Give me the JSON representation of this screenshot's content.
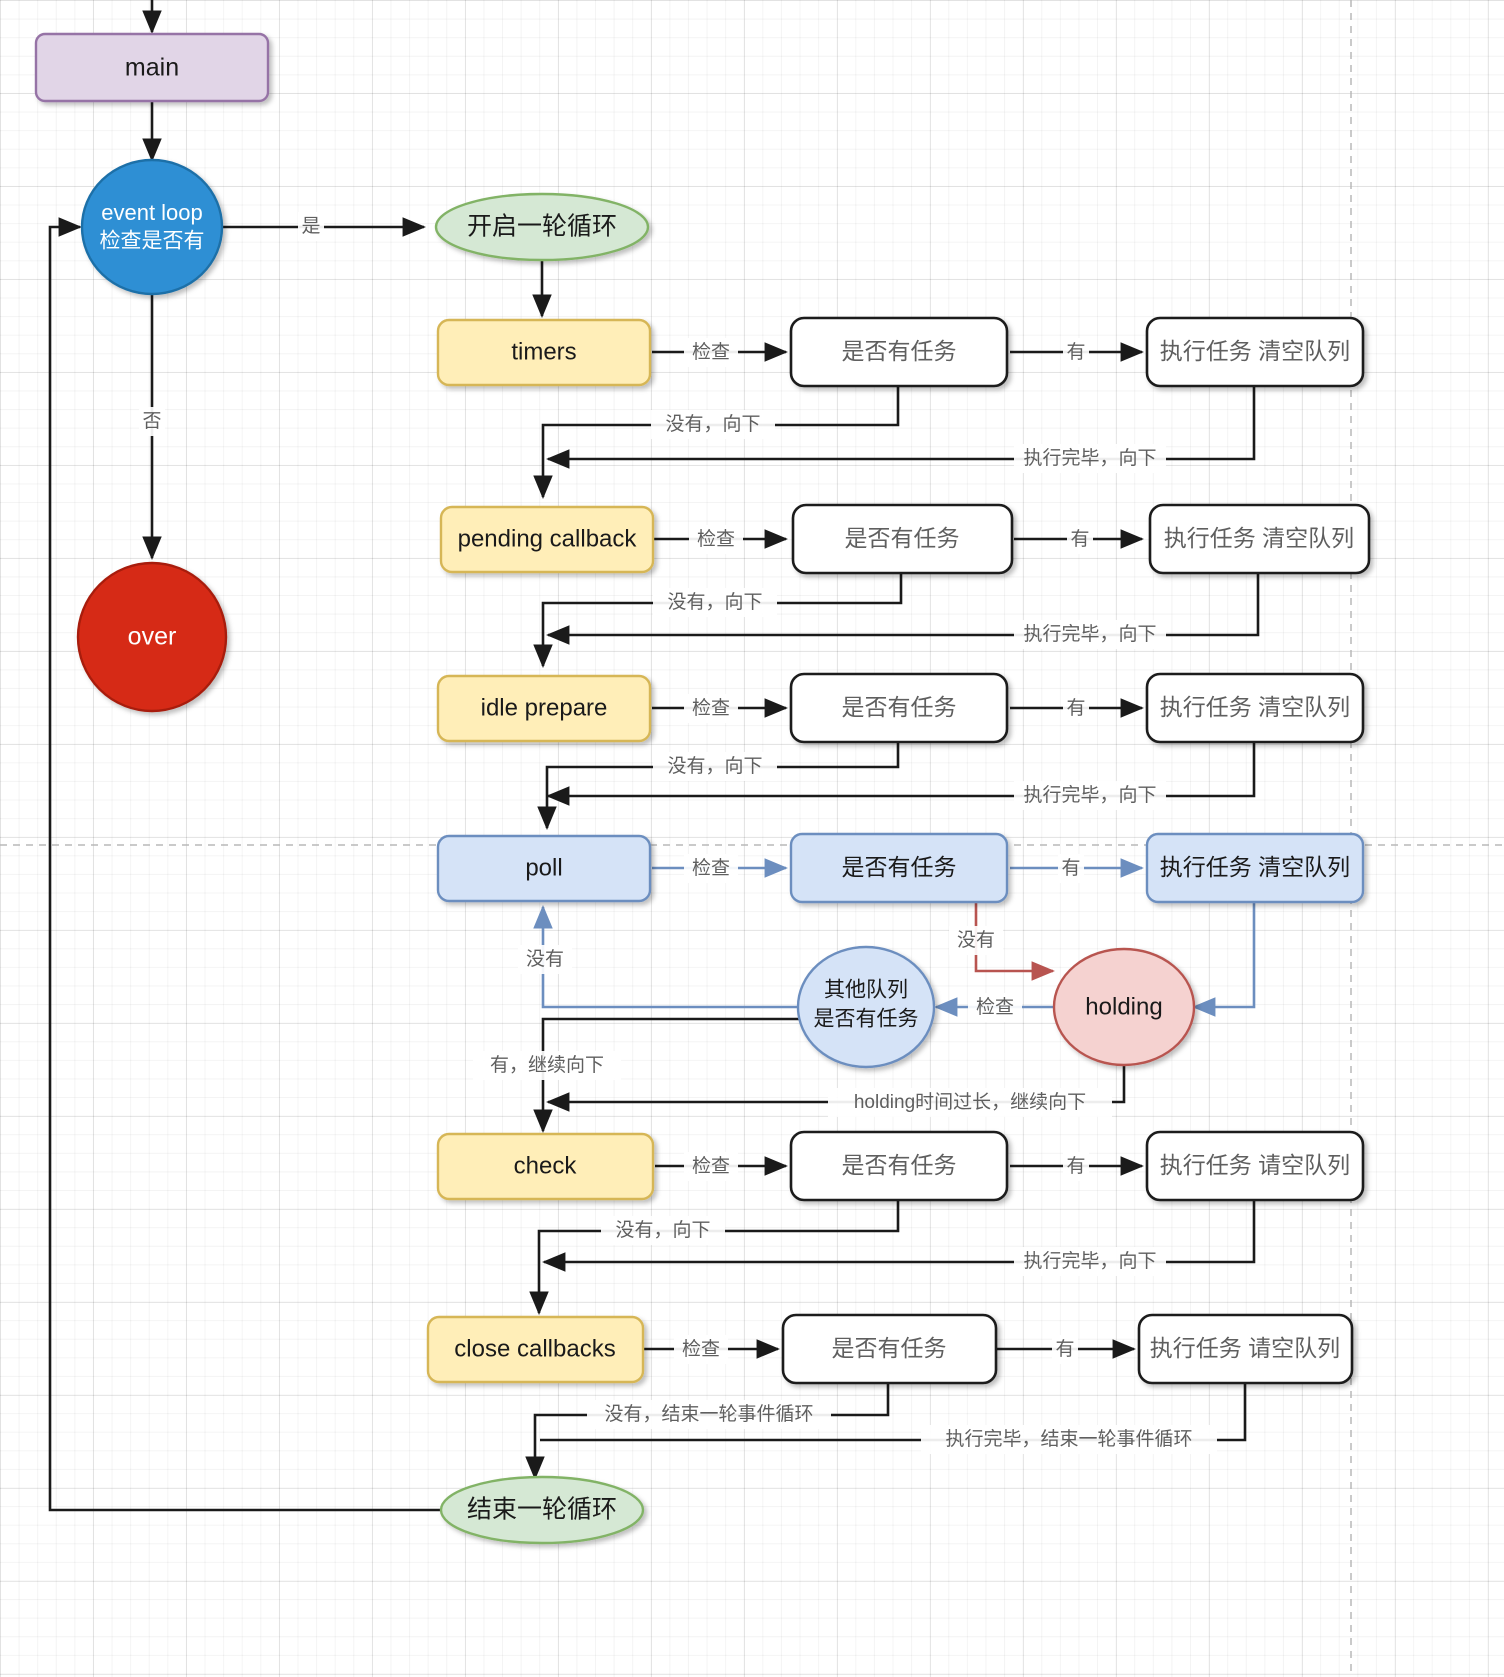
{
  "diagram": {
    "title": "Node.js event loop flowchart",
    "colors": {
      "main_fill": "#e1d5e7",
      "main_stroke": "#9673a6",
      "eventloop_fill": "#2f8fd4",
      "eventloop_stroke": "#1f6fa8",
      "over_fill": "#d62b13",
      "over_stroke": "#a81f0c",
      "ellipse_fill": "#d5e8d4",
      "ellipse_stroke": "#82b366",
      "phase_fill": "#ffeeb8",
      "phase_stroke": "#d6b656",
      "plain_fill": "#ffffff",
      "plain_stroke": "#1a1a1a",
      "poll_fill": "#d5e3f7",
      "poll_stroke": "#6c8ebf",
      "holding_fill": "#f5d2d0",
      "holding_stroke": "#b85450",
      "blue_edge": "#6c8ebf",
      "red_edge": "#b85450",
      "text_gray": "#5f5f5f",
      "text_dark": "#1a1a1a"
    },
    "nodes": {
      "main": "main",
      "event_loop_line1": "event loop",
      "event_loop_line2": "检查是否有",
      "over": "over",
      "start_round": "开启一轮循环",
      "end_round": "结束一轮循环",
      "timers": "timers",
      "pending_callback": "pending callback",
      "idle_prepare": "idle prepare",
      "poll": "poll",
      "check": "check",
      "close_callbacks": "close callbacks",
      "has_task": "是否有任务",
      "exec_clear_qing1": "执行任务 清空队列",
      "exec_clear_qing2": "执行任务 请空队列",
      "other_queue_line1": "其他队列",
      "other_queue_line2": "是否有任务",
      "holding": "holding"
    },
    "edge_labels": {
      "yes": "是",
      "no": "否",
      "check": "检查",
      "have": "有",
      "none": "没有",
      "none_down": "没有，向下",
      "done_down": "执行完毕，向下",
      "have_continue_down": "有，继续向下",
      "holding_too_long": "holding时间过长，继续向下",
      "none_end_round": "没有，结束一轮事件循环",
      "done_end_round": "执行完毕，结束一轮事件循环"
    },
    "rows": [
      {
        "id": "timers",
        "phase": "timers",
        "decision": "是否有任务",
        "action": "执行任务 清空队列",
        "style": "yellow"
      },
      {
        "id": "pending-callback",
        "phase": "pending callback",
        "decision": "是否有任务",
        "action": "执行任务 清空队列",
        "style": "yellow"
      },
      {
        "id": "idle-prepare",
        "phase": "idle prepare",
        "decision": "是否有任务",
        "action": "执行任务 清空队列",
        "style": "yellow"
      },
      {
        "id": "poll",
        "phase": "poll",
        "decision": "是否有任务",
        "action": "执行任务 清空队列",
        "style": "blue"
      },
      {
        "id": "check",
        "phase": "check",
        "decision": "是否有任务",
        "action": "执行任务 请空队列",
        "style": "yellow"
      },
      {
        "id": "close-callbacks",
        "phase": "close callbacks",
        "decision": "是否有任务",
        "action": "执行任务 请空队列",
        "style": "yellow"
      }
    ]
  }
}
